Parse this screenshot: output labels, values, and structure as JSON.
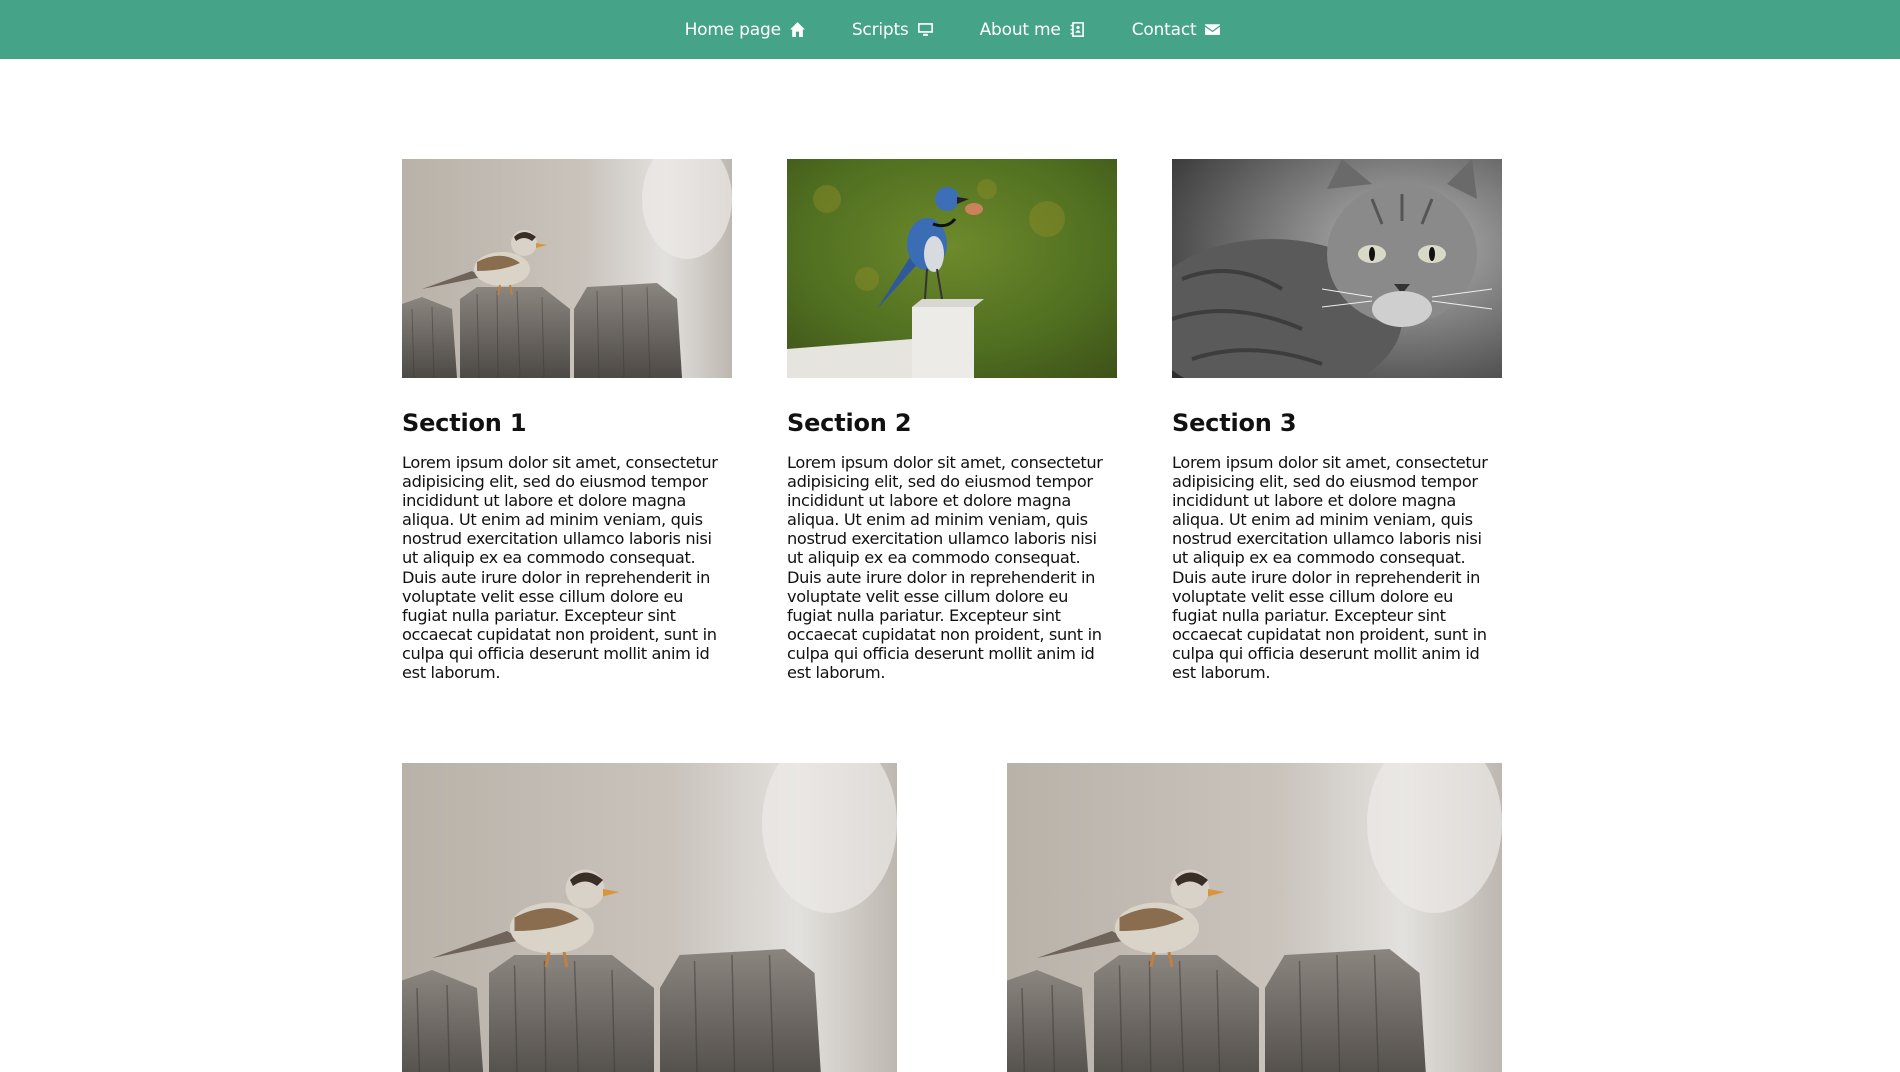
{
  "nav": {
    "items": [
      {
        "label": "Home page",
        "icon": "home-icon"
      },
      {
        "label": "Scripts",
        "icon": "desktop-icon"
      },
      {
        "label": "About me",
        "icon": "address-book-icon"
      },
      {
        "label": "Contact",
        "icon": "envelope-icon"
      }
    ],
    "bg_color": "#45a387"
  },
  "sections": [
    {
      "title": "Section 1",
      "image": "sparrow-on-fence-photo",
      "text": "Lorem ipsum dolor sit amet, consectetur adipisicing elit, sed do eiusmod tempor incididunt ut labore et dolore magna aliqua. Ut enim ad minim veniam, quis nostrud exercitation ullamco laboris nisi ut aliquip ex ea commodo consequat. Duis aute irure dolor in reprehenderit in voluptate velit esse cillum dolore eu fugiat nulla pariatur. Excepteur sint occaecat cupidatat non proident, sunt in culpa qui officia deserunt mollit anim id est laborum."
    },
    {
      "title": "Section 2",
      "image": "blue-jay-on-post-photo",
      "text": "Lorem ipsum dolor sit amet, consectetur adipisicing elit, sed do eiusmod tempor incididunt ut labore et dolore magna aliqua. Ut enim ad minim veniam, quis nostrud exercitation ullamco laboris nisi ut aliquip ex ea commodo consequat. Duis aute irure dolor in reprehenderit in voluptate velit esse cillum dolore eu fugiat nulla pariatur. Excepteur sint occaecat cupidatat non proident, sunt in culpa qui officia deserunt mollit anim id est laborum."
    },
    {
      "title": "Section 3",
      "image": "tabby-cat-bw-photo",
      "text": "Lorem ipsum dolor sit amet, consectetur adipisicing elit, sed do eiusmod tempor incididunt ut labore et dolore magna aliqua. Ut enim ad minim veniam, quis nostrud exercitation ullamco laboris nisi ut aliquip ex ea commodo consequat. Duis aute irure dolor in reprehenderit in voluptate velit esse cillum dolore eu fugiat nulla pariatur. Excepteur sint occaecat cupidatat non proident, sunt in culpa qui officia deserunt mollit anim id est laborum."
    }
  ],
  "gallery": [
    {
      "image": "sparrow-on-fence-photo"
    },
    {
      "image": "sparrow-on-fence-photo"
    }
  ]
}
